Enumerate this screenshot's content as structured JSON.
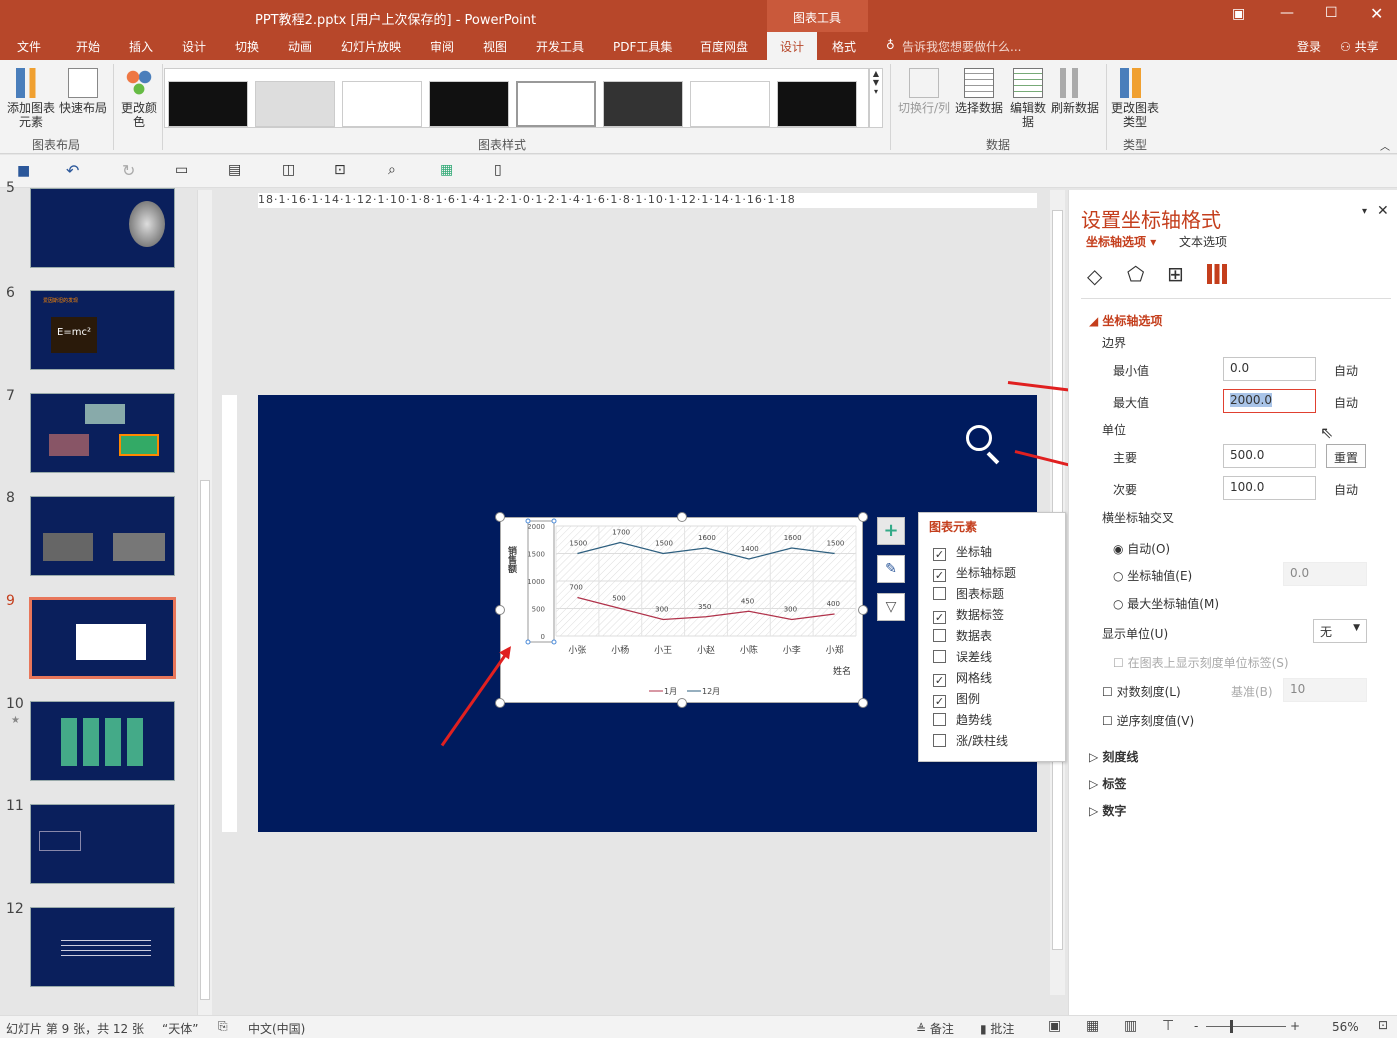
{
  "window": {
    "title": "PPT教程2.pptx [用户上次保存的] - PowerPoint",
    "context_group": "图表工具"
  },
  "tabs": [
    "文件",
    "开始",
    "插入",
    "设计",
    "切换",
    "动画",
    "幻灯片放映",
    "审阅",
    "视图",
    "开发工具",
    "PDF工具集",
    "百度网盘",
    "设计",
    "格式"
  ],
  "active_tab": "设计",
  "tell_me": "告诉我您想要做什么...",
  "signin": "登录",
  "share": "共享",
  "ribbon": {
    "groups": [
      {
        "label": "图表布局",
        "buttons": [
          "添加图表元素",
          "快速布局"
        ]
      },
      {
        "label": "",
        "buttons": [
          "更改颜色"
        ]
      },
      {
        "label": "图表样式",
        "buttons": []
      },
      {
        "label": "数据",
        "buttons": [
          "切换行/列",
          "选择数据",
          "编辑数据",
          "刷新数据"
        ]
      },
      {
        "label": "类型",
        "buttons": [
          "更改图表类型"
        ]
      }
    ]
  },
  "slides": {
    "numbers": [
      "5",
      "6",
      "7",
      "8",
      "9",
      "10",
      "11",
      "12"
    ],
    "selected": "9",
    "slide6_title": "爱因斯坦的发现",
    "slide6_formula": "E=mc²"
  },
  "ruler": {
    "top": "18·1·16·1·14·1·12·1·10·1·8·1·6·1·4·1·2·1·0·1·2·1·4·1·6·1·8·1·10·1·12·1·14·1·16·1·18"
  },
  "chart_data": {
    "type": "line",
    "categories": [
      "小张",
      "小杨",
      "小王",
      "小赵",
      "小陈",
      "小李",
      "小郑"
    ],
    "series": [
      {
        "name": "1月",
        "values": [
          700,
          500,
          300,
          350,
          450,
          300,
          400
        ],
        "color": "#b0324a"
      },
      {
        "name": "12月",
        "values": [
          1500,
          1700,
          1500,
          1600,
          1400,
          1600,
          1500
        ],
        "color": "#2e5f7f"
      }
    ],
    "xlabel": "姓名",
    "ylabel": "销售额",
    "ylim": [
      0,
      2000
    ],
    "yticks": [
      "0",
      "500",
      "1000",
      "1500",
      "2000"
    ],
    "grid": true,
    "legend": "bottom"
  },
  "chart_elements": {
    "title": "图表元素",
    "items": [
      {
        "label": "坐标轴",
        "checked": true
      },
      {
        "label": "坐标轴标题",
        "checked": true
      },
      {
        "label": "图表标题",
        "checked": false
      },
      {
        "label": "数据标签",
        "checked": true
      },
      {
        "label": "数据表",
        "checked": false
      },
      {
        "label": "误差线",
        "checked": false
      },
      {
        "label": "网格线",
        "checked": true
      },
      {
        "label": "图例",
        "checked": true
      },
      {
        "label": "趋势线",
        "checked": false
      },
      {
        "label": "涨/跌柱线",
        "checked": false
      }
    ]
  },
  "pane": {
    "title": "设置坐标轴格式",
    "tab1": "坐标轴选项",
    "tab2": "文本选项",
    "section": "坐标轴选项",
    "bounds": "边界",
    "min_label": "最小值",
    "min_value": "0.0",
    "min_btn": "自动",
    "max_label": "最大值",
    "max_value": "2000.0",
    "max_btn": "自动",
    "units": "单位",
    "major_label": "主要",
    "major_value": "500.0",
    "major_btn": "重置",
    "minor_label": "次要",
    "minor_value": "100.0",
    "minor_btn": "自动",
    "cross": "横坐标轴交叉",
    "cross_auto": "自动(O)",
    "cross_value_label": "坐标轴值(E)",
    "cross_value": "0.0",
    "cross_max": "最大坐标轴值(M)",
    "display_units": "显示单位(U)",
    "display_units_value": "无",
    "show_units_label": "在图表上显示刻度单位标签(S)",
    "log_label": "对数刻度(L)",
    "base_label": "基准(B)",
    "base_value": "10",
    "reverse_label": "逆序刻度值(V)",
    "collapsed": [
      "刻度线",
      "标签",
      "数字"
    ]
  },
  "status": {
    "slide_info": "幻灯片 第 9 张，共 12 张",
    "theme": "“天体”",
    "language": "中文(中国)",
    "notes": "备注",
    "comments": "批注",
    "zoom": "56%"
  },
  "colors": {
    "accent": "#b7472a",
    "slide_bg": "#001b5e",
    "arrow": "#e02020"
  }
}
